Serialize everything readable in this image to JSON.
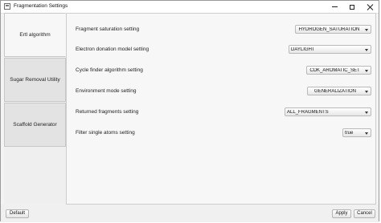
{
  "window": {
    "title": "Fragmentation Settings"
  },
  "tabs": [
    {
      "label": "Ertl algorithm",
      "active": true
    },
    {
      "label": "Sugar Removal Utility",
      "active": false
    },
    {
      "label": "Scaffold Generator",
      "active": false
    }
  ],
  "settings": [
    {
      "label": "Fragment saturation setting",
      "value": "HYDROGEN_SATURATION"
    },
    {
      "label": "Electron donation model setting",
      "value": "DAYLIGHT"
    },
    {
      "label": "Cycle finder algorithm setting",
      "value": "CDK_AROMATIC_SET"
    },
    {
      "label": "Environment mode setting",
      "value": "GENERALIZATION"
    },
    {
      "label": "Returned fragments setting",
      "value": "ALL_FRAGMENTS"
    },
    {
      "label": "Filter single atoms setting",
      "value": "true"
    }
  ],
  "buttons": {
    "default_label": "Default",
    "apply_label": "Apply",
    "cancel_label": "Cancel"
  },
  "icons": {
    "app": "app-window-icon",
    "minimize": "minimize-icon",
    "maximize": "maximize-icon",
    "close": "close-icon",
    "dropdown": "chevron-down-icon"
  }
}
